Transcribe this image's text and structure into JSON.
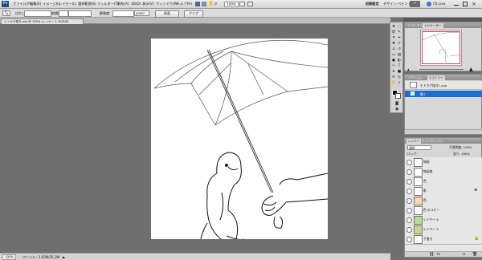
{
  "menubar": {
    "items": [
      "ファイル(F)",
      "編集(E)",
      "イメージ(I)",
      "レイヤー(L)",
      "選択範囲(S)",
      "フィルター(T)",
      "解析(A)",
      "3D(D)",
      "表示(V)",
      "ウィンドウ(W)",
      "ヘルプ(H)"
    ],
    "zoom": "100%",
    "workspace": "初期設定",
    "design": "デザイン",
    "paint": "ペイント",
    "more": "»",
    "cslive": "CS Live"
  },
  "options": {
    "label1": "ぼかし:",
    "label2": "縦横比:",
    "label3": "解像度:",
    "unit": "pixel/...",
    "front_button": "前面",
    "clear_button": "クリア"
  },
  "document": {
    "tab_label": "ヒトカゲ描き.psd @ 100% (レイヤー 1, RGB/8)"
  },
  "status": {
    "zoom": "100%",
    "file_info": "ファイル : 1.83M/35.3M"
  },
  "navigator": {
    "tabs": [
      "ナビゲーター",
      "ヒストグラム"
    ],
    "accent_color": "#e03a4f"
  },
  "history": {
    "tabs": [
      "ヒストリー",
      "アクション"
    ],
    "items": [
      "ヒトカゲ描き1.psd",
      "開く"
    ]
  },
  "layers": {
    "tabs": [
      "レイヤー",
      "チャンネル",
      "パス"
    ],
    "blend_mode": "通常",
    "opacity": "不透明度: 100%",
    "lock_label": "ロック:",
    "fill": "塗り: 100%",
    "rows": [
      "線画",
      "線画線",
      "色",
      "影",
      "色",
      "色 のコピー",
      "レイヤー 4",
      "レイヤー 3",
      "下書き"
    ]
  },
  "colors": {
    "selection_blue": "#1a6fd4",
    "canvas_bg": "#6f6f6f"
  },
  "icons": [
    "move-icon",
    "marquee-icon",
    "lasso-icon",
    "quick-select-icon",
    "crop-icon",
    "eyedropper-icon",
    "healing-icon",
    "brush-icon",
    "stamp-icon",
    "history-brush-icon",
    "eraser-icon",
    "gradient-icon",
    "blur-icon",
    "dodge-icon",
    "pen-icon",
    "type-icon",
    "path-select-icon",
    "shape-icon",
    "hand-icon",
    "zoom-icon",
    "eye-icon",
    "lock-icon",
    "trash-icon"
  ]
}
